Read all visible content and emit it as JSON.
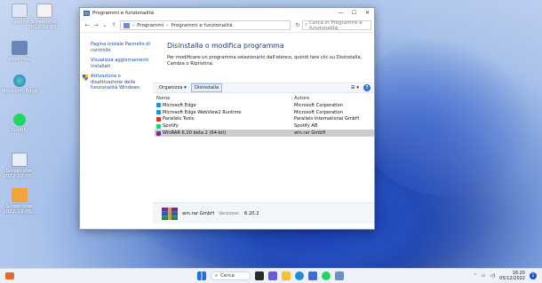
{
  "desktop": {
    "icons": [
      {
        "label": "Cestino"
      },
      {
        "label": "Screenshot 2022-12-05…"
      },
      {
        "label": "Vino Mac"
      },
      {
        "label": "Microsoft Edge"
      },
      {
        "label": "Spotify"
      },
      {
        "label": "Screenshot 2022-12-05…"
      },
      {
        "label": "Screenshot 2022-12-05…"
      }
    ]
  },
  "window": {
    "title": "Programmi e funzionalità",
    "breadcrumb": [
      "Programmi",
      "Programmi e funzionalità"
    ],
    "search_placeholder": "Cerca in Programmi e funzionalità",
    "sidebar": {
      "links": [
        "Pagina iniziale Pannello di controllo",
        "Visualizza aggiornamenti installati",
        "Attivazione o disattivazione delle funzionalità Windows"
      ]
    },
    "heading": "Disinstalla o modifica programma",
    "description": "Per modificare un programma selezionarlo dall'elenco, quindi fare clic su Disinstalla, Cambia o Ripristina.",
    "toolbar": {
      "organize": "Organizza",
      "uninstall": "Disinstalla"
    },
    "columns": {
      "name": "Nome",
      "publisher": "Autore"
    },
    "programs": [
      {
        "name": "Microsoft Edge",
        "publisher": "Microsoft Corporation",
        "color": "#1b8fd6"
      },
      {
        "name": "Microsoft Edge WebView2 Runtime",
        "publisher": "Microsoft Corporation",
        "color": "#1b8fd6"
      },
      {
        "name": "Parallels Tools",
        "publisher": "Parallels International GmbH",
        "color": "#d9302b"
      },
      {
        "name": "Spotify",
        "publisher": "Spotify AB",
        "color": "#1ed760"
      },
      {
        "name": "WinRAR 6.20 beta 2 (64-bit)",
        "publisher": "win.rar GmbH",
        "color": "#7a2a8a",
        "selected": true
      }
    ],
    "details": {
      "publisher": "win.rar GmbH",
      "version_label": "Versione:",
      "version": "6.20.2"
    }
  },
  "taskbar": {
    "search_label": "Cerca",
    "time": "16:20",
    "date": "05/12/2022",
    "notification_count": "1"
  }
}
